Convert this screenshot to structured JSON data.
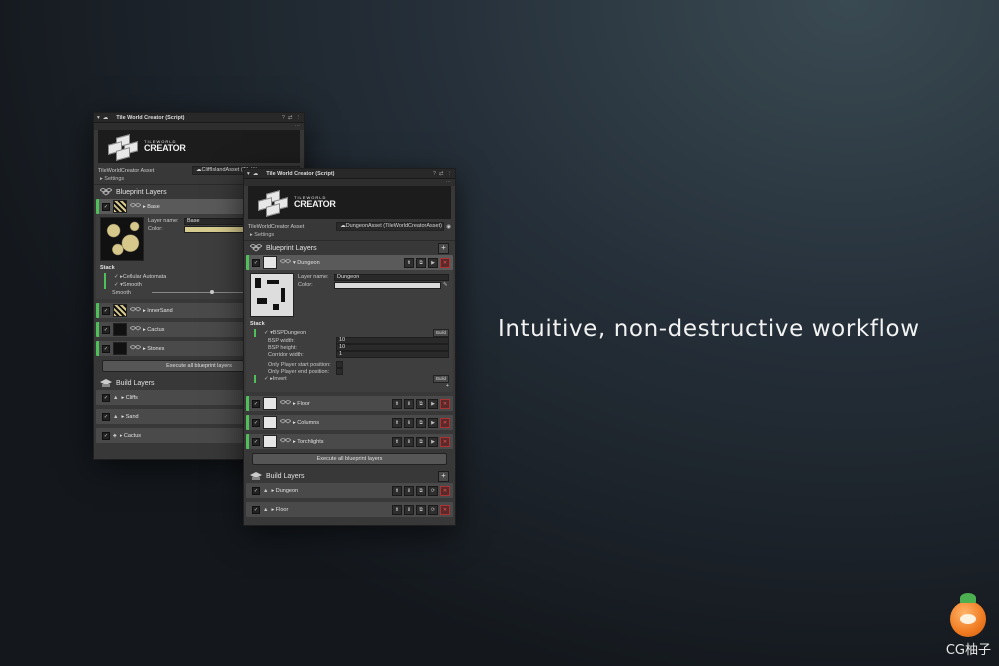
{
  "tagline": "Intuitive, non-destructive workflow",
  "watermark": {
    "text": "CG柚子"
  },
  "back_window": {
    "title": "Tile World Creator (Script)",
    "logo": {
      "small": "TILEWORLD",
      "big": "CREATOR"
    },
    "asset_label": "TileWorldCreator Asset",
    "asset_value": "☁CliffIslandAsset (TileW",
    "settings": "Settings",
    "blueprint_header": "Blueprint Layers",
    "layers": [
      {
        "name": "Base"
      },
      {
        "name": "InnerSand"
      },
      {
        "name": "Cactus"
      },
      {
        "name": "Stones"
      }
    ],
    "detail": {
      "layer_name_label": "Layer name:",
      "layer_name_value": "Base",
      "color_label": "Color:",
      "stack_label": "Stack",
      "stack_items": [
        "Cellular Automata",
        "Smooth"
      ],
      "smooth_label": "Smooth"
    },
    "exec_label": "Execute all blueprint layers",
    "build_header": "Build Layers",
    "build_layers": [
      {
        "name": "Cliffs"
      },
      {
        "name": "Sand"
      },
      {
        "name": "Cactus"
      }
    ]
  },
  "front_window": {
    "title": "Tile World Creator (Script)",
    "logo": {
      "small": "TILEWORLD",
      "big": "CREATOR"
    },
    "asset_label": "TileWorldCreator Asset",
    "asset_value": "☁DungeonAsset (TileWorldCreatorAsset)",
    "settings": "Settings",
    "blueprint_header": "Blueprint Layers",
    "layers": [
      {
        "name": "Dungeon"
      },
      {
        "name": "Floor"
      },
      {
        "name": "Columns"
      },
      {
        "name": "Torchlights"
      }
    ],
    "detail": {
      "layer_name_label": "Layer name:",
      "layer_name_value": "Dungeon",
      "color_label": "Color:",
      "stack_label": "Stack",
      "stack_items": [
        "BSPDungeon",
        "Invert"
      ],
      "build_label": "Build",
      "fields": [
        {
          "label": "BSP width:",
          "value": "10"
        },
        {
          "label": "BSP height:",
          "value": "10"
        },
        {
          "label": "Corridor width:",
          "value": "1"
        }
      ],
      "checks": [
        {
          "label": "Only Player start position:"
        },
        {
          "label": "Only Player end position:"
        }
      ]
    },
    "exec_label": "Execute all blueprint layers",
    "build_header": "Build Layers",
    "build_layers": [
      {
        "name": "Dungeon"
      },
      {
        "name": "Floor"
      }
    ]
  }
}
